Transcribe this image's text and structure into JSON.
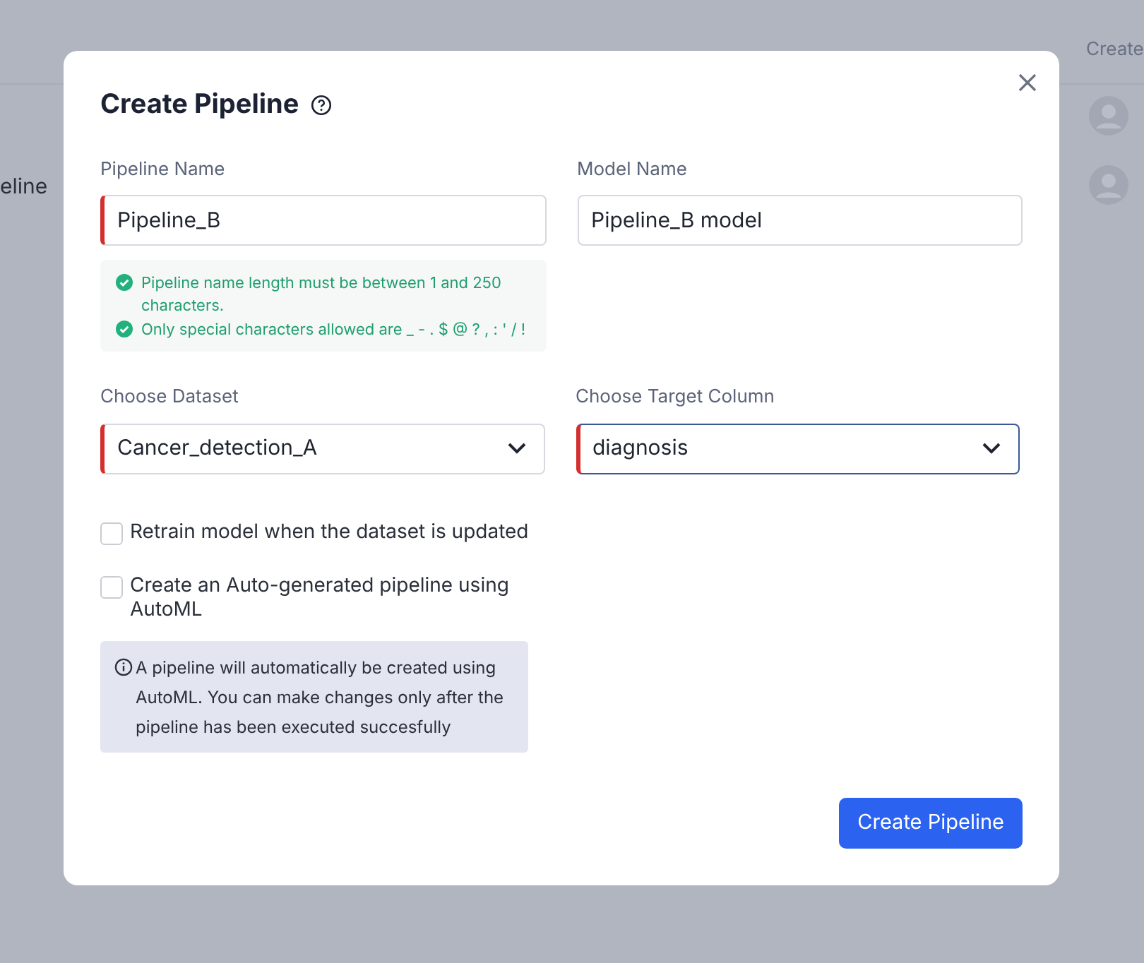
{
  "background": {
    "columns": [
      "Create"
    ],
    "rows": [
      {
        "name": ""
      },
      {
        "name": "eline"
      }
    ]
  },
  "dialog": {
    "title": "Create Pipeline",
    "fields": [
      {
        "label": "Pipeline Name",
        "kind": "text",
        "value": "Pipeline_B",
        "invalid": true,
        "focused": false
      },
      {
        "label": "Model Name",
        "kind": "text",
        "value": "Pipeline_B model",
        "invalid": false,
        "focused": false
      }
    ],
    "rules": [
      {
        "text": "Pipeline name length must be between 1 and 250 characters.",
        "passed": true
      },
      {
        "text": "Only special characters allowed are _ - . $ @ ? , : ' / !",
        "passed": true
      }
    ],
    "selects": [
      {
        "label": "Choose Dataset",
        "kind": "select",
        "value": "Cancer_detection_A",
        "invalid": true,
        "focused": false
      },
      {
        "label": "Choose Target Column",
        "kind": "select",
        "value": "diagnosis",
        "invalid": true,
        "focused": true
      }
    ],
    "options": [
      {
        "label": "Retrain model when the dataset is updated",
        "checked": false
      },
      {
        "label": "Create an Auto-generated pipeline using AutoML",
        "checked": false
      }
    ],
    "info": "A pipeline will automatically be created using AutoML. You can make changes only after the pipeline has been executed succesfully",
    "submit": "Create Pipeline"
  }
}
